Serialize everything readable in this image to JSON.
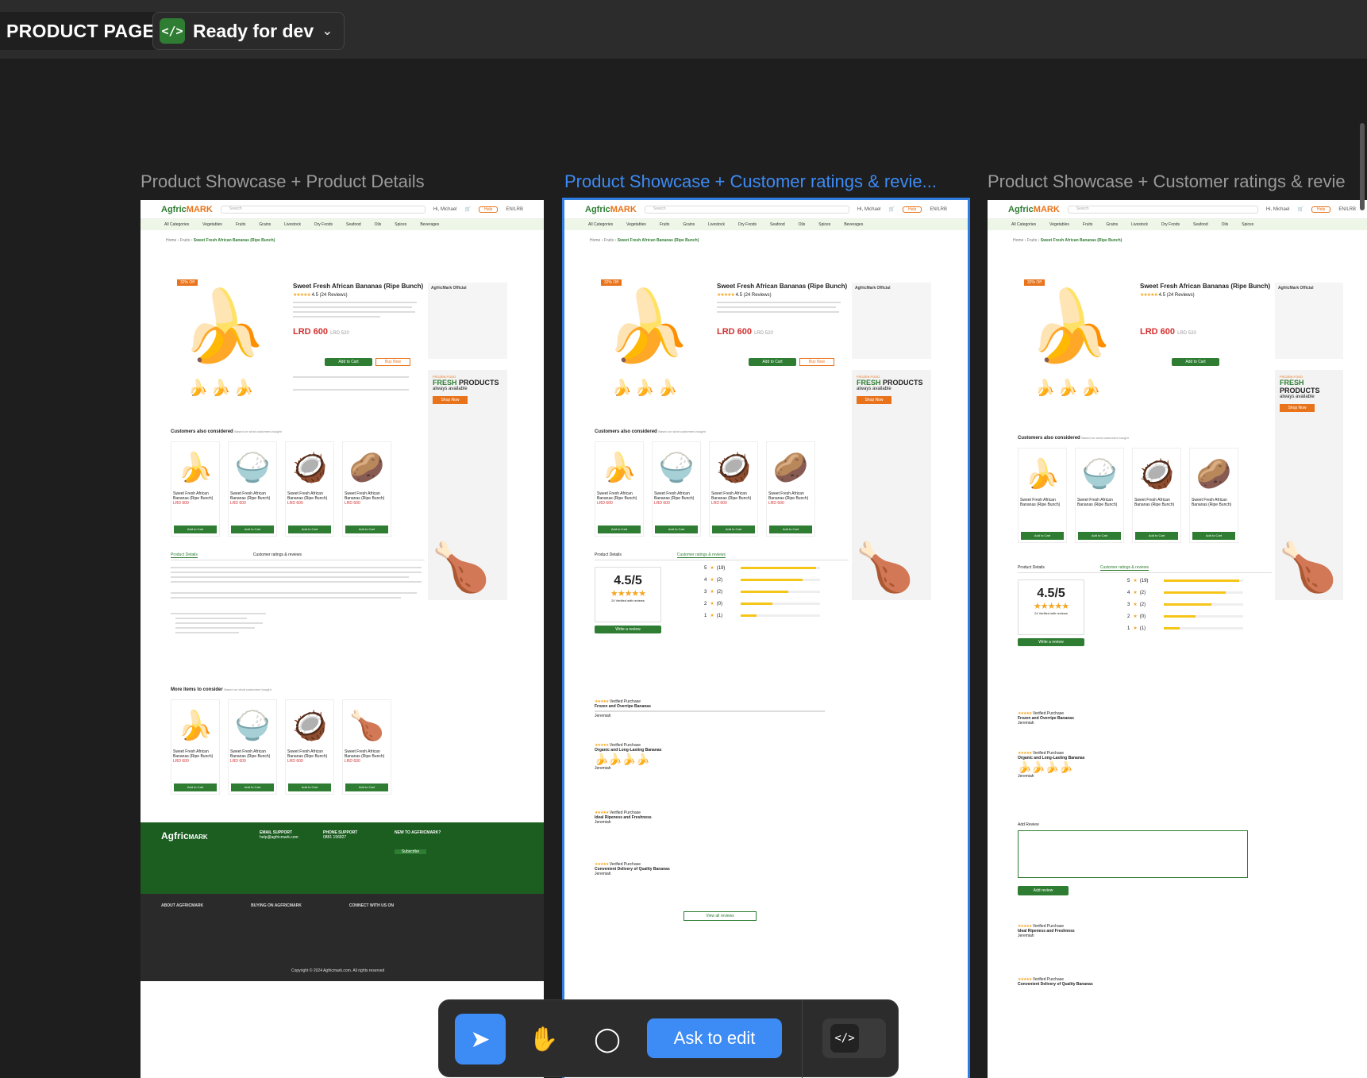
{
  "top_bar": {
    "page_name": "PRODUCT PAGE",
    "status_label": "Ready for dev",
    "status_icon": "code-icon"
  },
  "frames": [
    {
      "label": "Product Showcase + Product Details",
      "selected": false
    },
    {
      "label": "Product Showcase + Customer ratings & revie...",
      "selected": true
    },
    {
      "label": "Product Showcase + Customer ratings & revie",
      "selected": false
    }
  ],
  "mock": {
    "logo_main": "Agfric",
    "logo_accent": "MARK",
    "search_placeholder": "Search",
    "user_greeting": "Hi, Michael",
    "help_label": "Help",
    "currency": "EN/LRB",
    "categories": [
      "All Categories",
      "Vegetables",
      "Fruits",
      "Grains",
      "Livestock",
      "Dry Foods",
      "Seafood",
      "Oils",
      "Spices",
      "Beverages"
    ],
    "breadcrumb": [
      "Home",
      "Fruits",
      "Sweet Fresh African Bananas (Ripe Bunch)"
    ],
    "discount_tag": "32% Off",
    "product_title": "Sweet Fresh African Bananas (Ripe Bunch)",
    "rating_text": "4.5 (24 Reviews)",
    "price": "LRD 600",
    "old_price": "LRD 520",
    "add_to_cart": "Add to Cart",
    "buy_now": "Buy Now",
    "seller_name": "AgfricMark Official",
    "promo_small": "FROZEN FOOD",
    "promo_fresh": "FRESH",
    "promo_products": "PRODUCTS",
    "promo_sub": "always available",
    "shop_now": "Shop Now",
    "customers_considered": "Customers also considered",
    "based_on": "Based on what customers bought",
    "tab_details": "Product Details",
    "tab_reviews": "Customer ratings & reviews",
    "more_items": "More items to consider",
    "card_title": "Sweet Fresh African Bananas (Ripe Bunch)",
    "card_price": "LRD 600",
    "footer_logo": "Agfric",
    "footer_logo_accent": "MARK",
    "email_support": "EMAIL SUPPORT",
    "email_value": "help@agfricmark.com",
    "phone_support": "PHONE SUPPORT",
    "phone_value": "0881 196827",
    "newsletter_title": "NEW TO AGFRICMARK?",
    "subscribe": "Subscribe",
    "about_title": "ABOUT AGFRICMARK",
    "buying_title": "BUYING ON AGFRICMARK",
    "connect_title": "CONNECT WITH US ON",
    "copyright": "Copyright © 2024 Agfricmark.com. All rights reserved",
    "score": "4.5/5",
    "verified": "24 Verified with reviews",
    "write_review": "Write a review",
    "rating_bars": [
      {
        "stars": "5",
        "count": "(19)",
        "fraction": 0.95
      },
      {
        "stars": "4",
        "count": "(2)",
        "fraction": 0.78
      },
      {
        "stars": "3",
        "count": "(2)",
        "fraction": 0.6
      },
      {
        "stars": "2",
        "count": "(0)",
        "fraction": 0.4
      },
      {
        "stars": "1",
        "count": "(1)",
        "fraction": 0.2
      }
    ],
    "review_titles": [
      "Frozen and Overripe Bananas",
      "Organic and Long-Lasting Bananas",
      "Ideal Ripeness and Freshness",
      "Convenient Delivery of Quality Bananas"
    ],
    "reviewer": "Jeremiah",
    "verified_purchase": "Verified Purchase",
    "view_all": "View all reviews",
    "add_review": "Add Review",
    "add_review_button": "Add review"
  },
  "toolbar": {
    "ask_to_edit": "Ask to edit",
    "tools": [
      "cursor-icon",
      "hand-icon",
      "comment-icon"
    ],
    "code_icon": "code-icon"
  }
}
